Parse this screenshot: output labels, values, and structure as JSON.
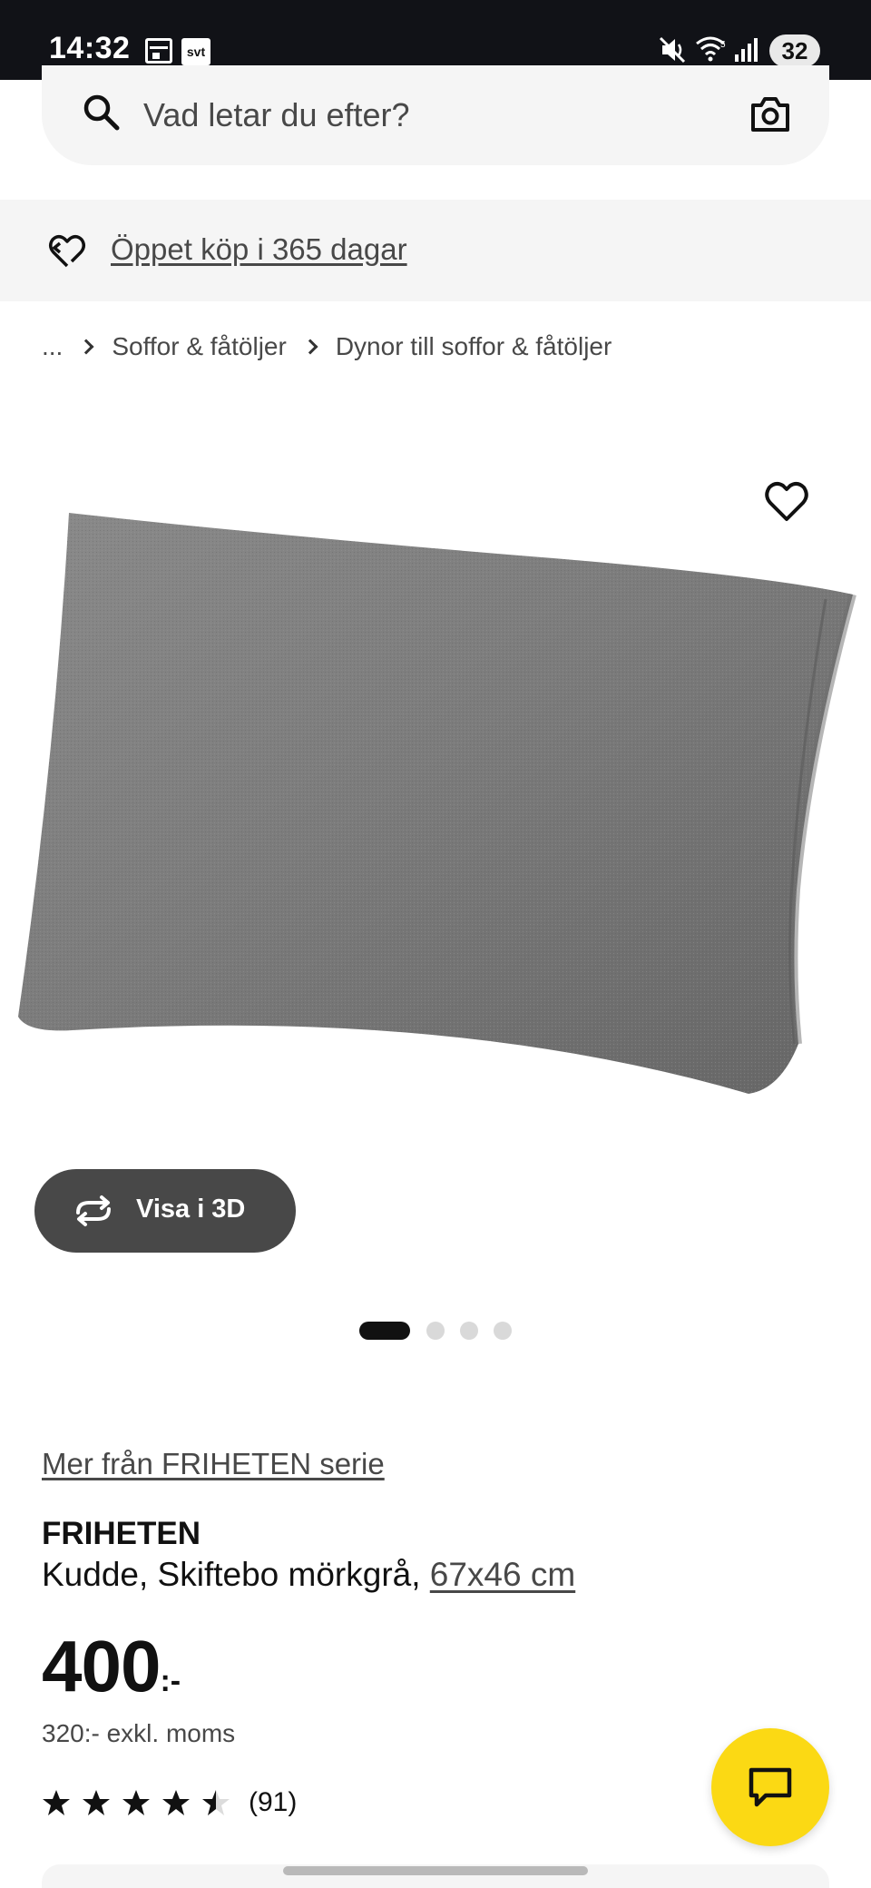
{
  "status_bar": {
    "time": "14:32",
    "battery": "32",
    "svt_label": "svt"
  },
  "search": {
    "placeholder": "Vad letar du efter?"
  },
  "banner": {
    "text": "Öppet köp i 365 dagar"
  },
  "breadcrumb": {
    "items": [
      "...",
      "Soffor & fåtöljer",
      "Dynor till soffor & fåtöljer"
    ]
  },
  "gallery": {
    "view_3d_label": "Visa i 3D",
    "image_count": 4,
    "active_index": 0
  },
  "product": {
    "series_link": "Mer från FRIHETEN serie",
    "name": "FRIHETEN",
    "description": "Kudde, Skiftebo mörkgrå, ",
    "size": "67x46 cm",
    "price_integer": "400",
    "price_suffix": ":-",
    "price_excl_vat": "320:- exkl. moms",
    "rating": 4.5,
    "rating_max": 5,
    "review_count": "(91)"
  },
  "colors": {
    "accent_yellow": "#fbd914",
    "dark_button": "#484848",
    "status_bar_bg": "#111217"
  },
  "icons": [
    "calendar-icon",
    "svt-icon",
    "mute-icon",
    "wifi-icon",
    "signal-icon",
    "search-icon",
    "camera-icon",
    "heart-return-icon",
    "favorite-heart-icon",
    "rotate-3d-icon",
    "star-icon",
    "chat-icon"
  ]
}
